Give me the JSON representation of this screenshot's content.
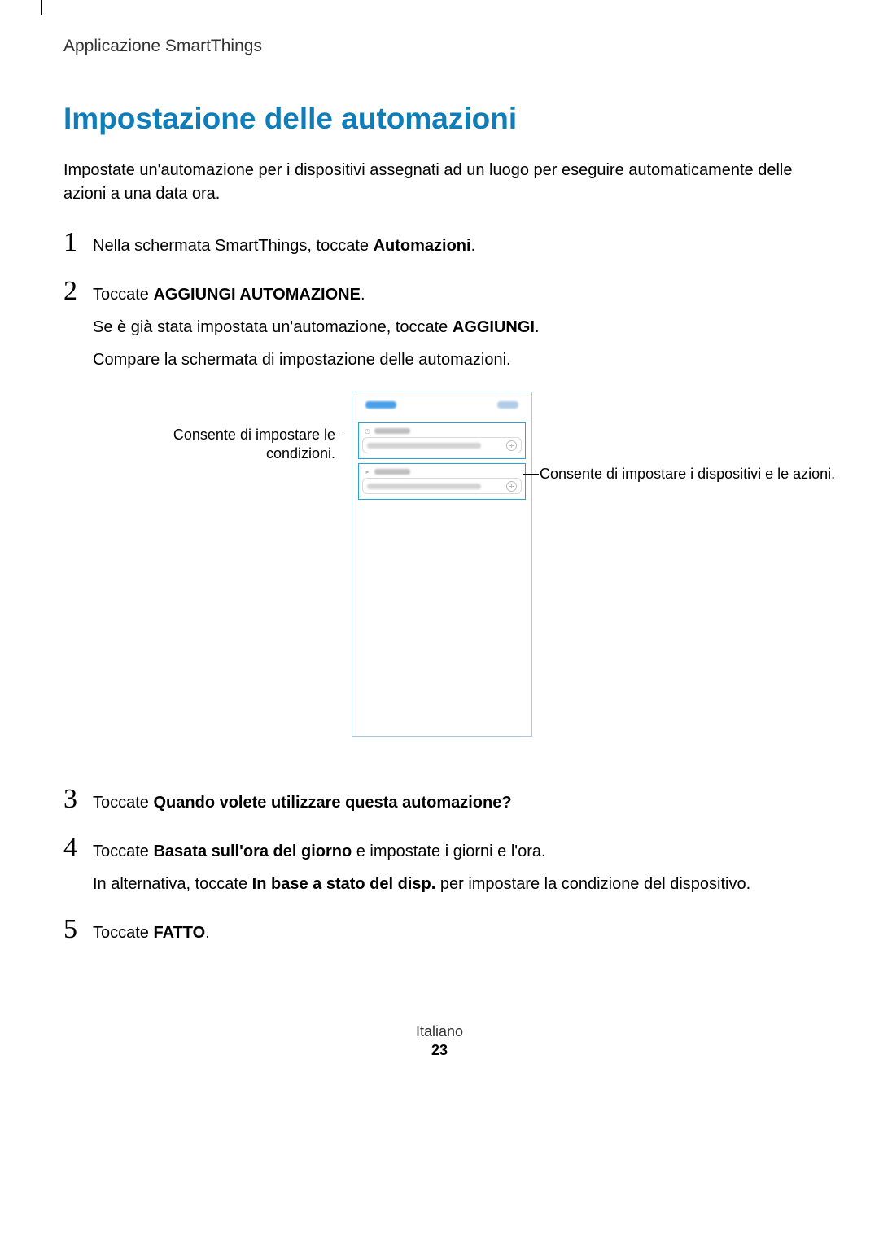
{
  "header": "Applicazione SmartThings",
  "title": "Impostazione delle automazioni",
  "intro": "Impostate un'automazione per i dispositivi assegnati ad un luogo per eseguire automaticamente delle azioni a una data ora.",
  "steps": {
    "s1": {
      "num": "1",
      "pre": "Nella schermata SmartThings, toccate ",
      "bold": "Automazioni",
      "post": "."
    },
    "s2": {
      "num": "2",
      "line1_pre": "Toccate ",
      "line1_bold": "AGGIUNGI AUTOMAZIONE",
      "line1_post": ".",
      "line2_pre": "Se è già stata impostata un'automazione, toccate ",
      "line2_bold": "AGGIUNGI",
      "line2_post": ".",
      "line3": "Compare la schermata di impostazione delle automazioni."
    },
    "s3": {
      "num": "3",
      "pre": "Toccate ",
      "bold": "Quando volete utilizzare questa automazione?"
    },
    "s4": {
      "num": "4",
      "line1_pre": "Toccate ",
      "line1_bold": "Basata sull'ora del giorno",
      "line1_post": " e impostate i giorni e l'ora.",
      "line2_pre": "In alternativa, toccate ",
      "line2_bold": "In base a stato del disp.",
      "line2_post": " per impostare la condizione del dispositivo."
    },
    "s5": {
      "num": "5",
      "pre": "Toccate ",
      "bold": "FATTO",
      "post": "."
    }
  },
  "callouts": {
    "left": "Consente di impostare le condizioni.",
    "right": "Consente di impostare i dispositivi e le azioni."
  },
  "footer": {
    "lang": "Italiano",
    "page": "23"
  }
}
